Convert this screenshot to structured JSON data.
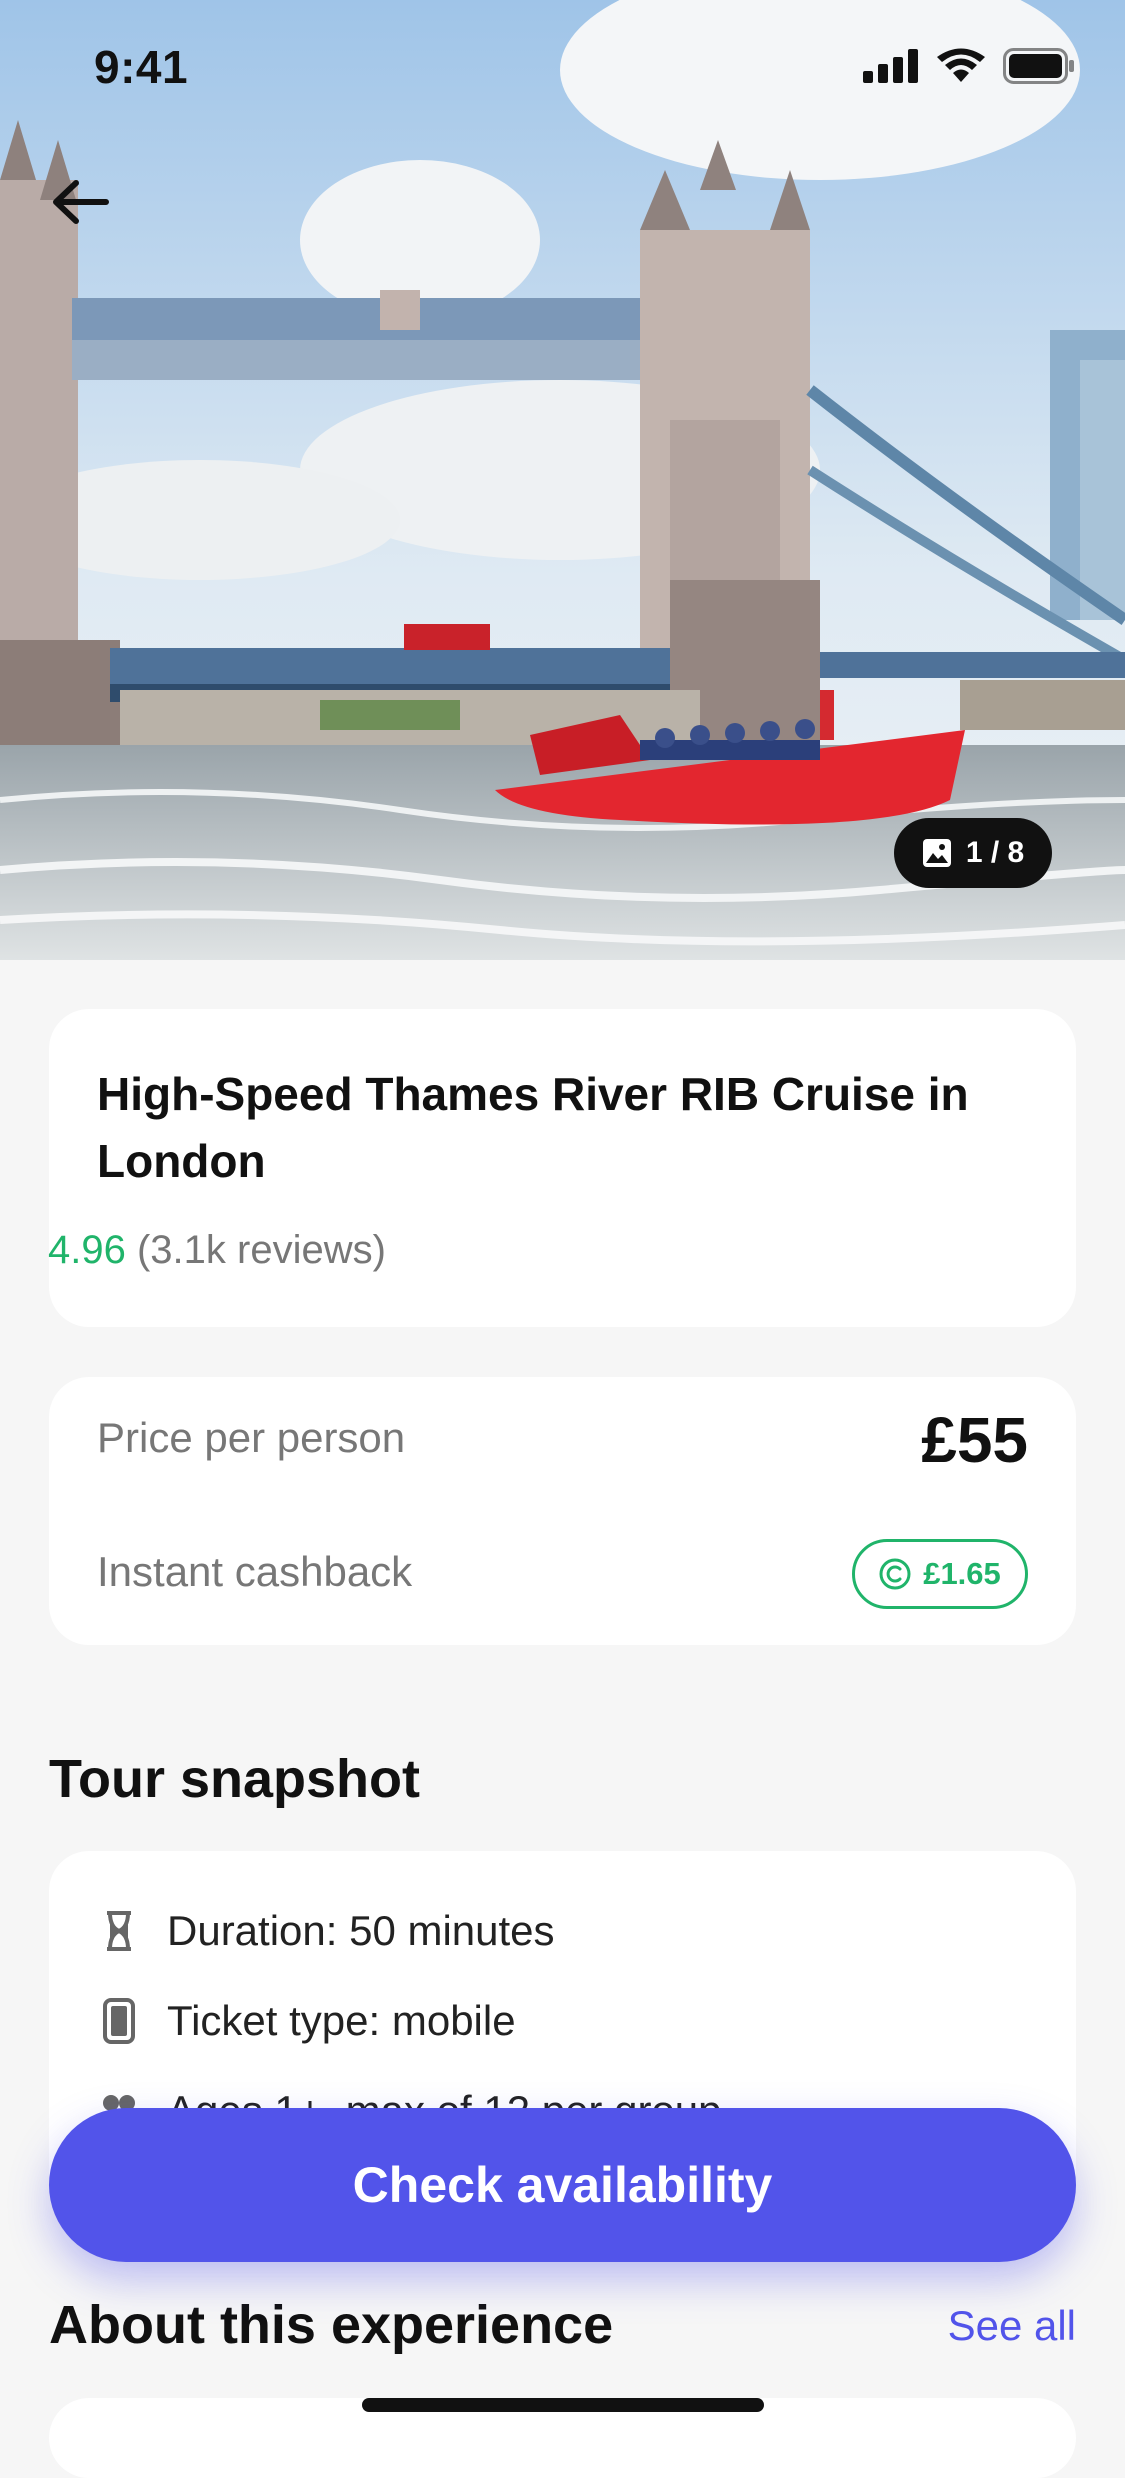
{
  "status_bar": {
    "time": "9:41"
  },
  "hero": {
    "counter": "1 / 8",
    "photo_icon": "image-icon"
  },
  "experience": {
    "title": "High-Speed Thames River RIB Cruise in London",
    "rating": "4.96",
    "reviews": "(3.1k reviews)"
  },
  "pricing": {
    "price_label": "Price per person",
    "price": "£55",
    "cashback_label": "Instant cashback",
    "cashback_value": "£1.65"
  },
  "snapshot": {
    "title": "Tour snapshot",
    "items": [
      {
        "icon": "hourglass-icon",
        "text": "Duration: 50 minutes"
      },
      {
        "icon": "phone-icon",
        "text": "Ticket type: mobile"
      },
      {
        "icon": "group-icon",
        "text": "Ages 1+, max of 12 per group"
      }
    ]
  },
  "cta": {
    "label": "Check availability"
  },
  "about": {
    "title": "About this experience",
    "see_all": "See all"
  },
  "colors": {
    "accent": "#5254ea",
    "success": "#20b46a",
    "background": "#f6f6f6"
  }
}
